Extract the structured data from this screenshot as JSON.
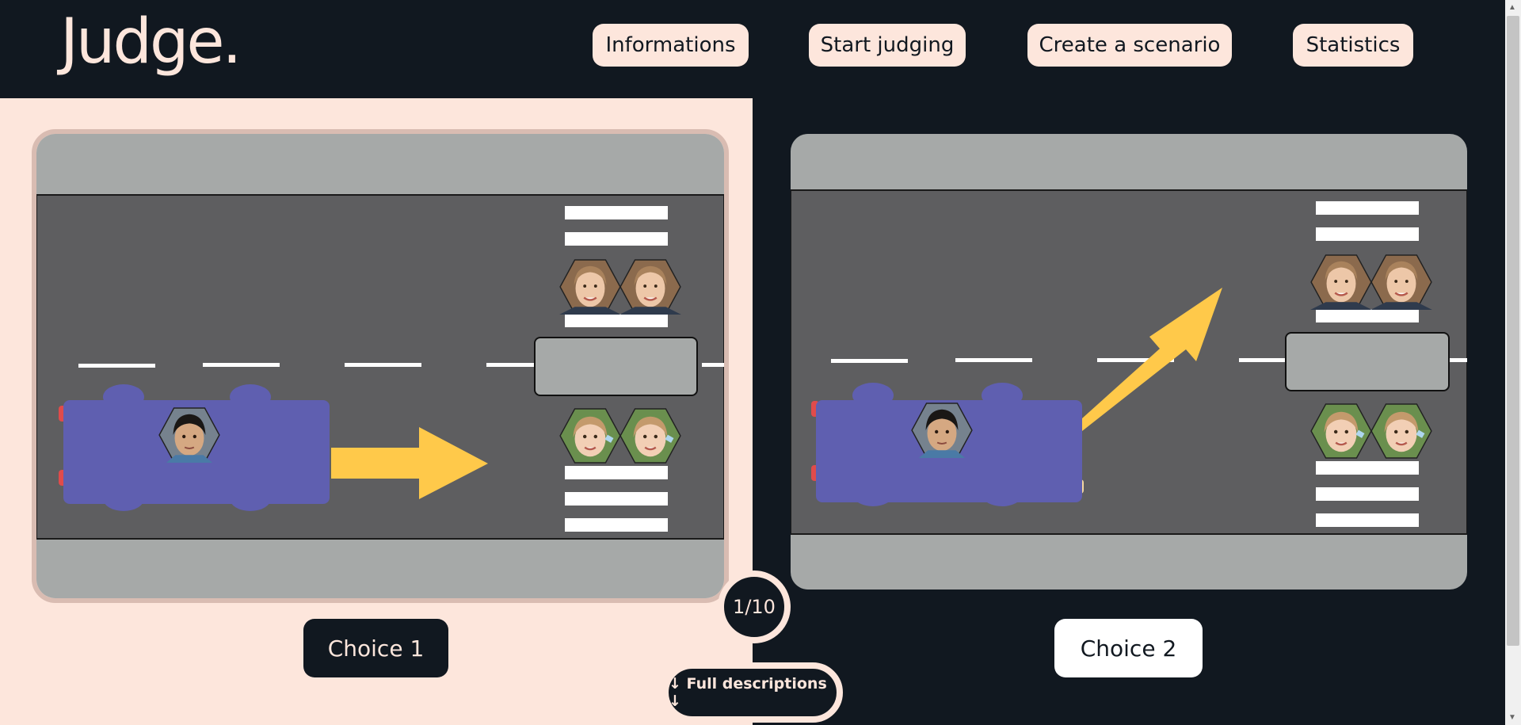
{
  "app": {
    "logo": "Judge."
  },
  "nav": {
    "informations": "Informations",
    "start_judging": "Start judging",
    "create_scenario": "Create a scenario",
    "statistics": "Statistics"
  },
  "choices": {
    "choice1_label": "Choice 1",
    "choice2_label": "Choice 2"
  },
  "progress": {
    "text": "1/10",
    "current": 1,
    "total": 10
  },
  "descriptions_button": "↓ Full descriptions ↓",
  "colors": {
    "background_dark": "#111820",
    "accent_cream": "#fde6dc",
    "road": "#5e5e60",
    "sidewalk": "#a6a9a8",
    "car": "#5f5fb0",
    "arrow": "#ffc94a",
    "lane_marking": "#ffffff"
  },
  "scenarios": [
    {
      "id": "choice-1",
      "car_occupants": [
        "boy"
      ],
      "pedestrians_top": [
        "woman",
        "woman"
      ],
      "pedestrians_bottom": [
        "girl",
        "girl"
      ],
      "maneuver": "straight"
    },
    {
      "id": "choice-2",
      "car_occupants": [
        "boy"
      ],
      "pedestrians_top": [
        "woman",
        "woman"
      ],
      "pedestrians_bottom": [
        "girl",
        "girl"
      ],
      "maneuver": "swerve-up"
    }
  ]
}
